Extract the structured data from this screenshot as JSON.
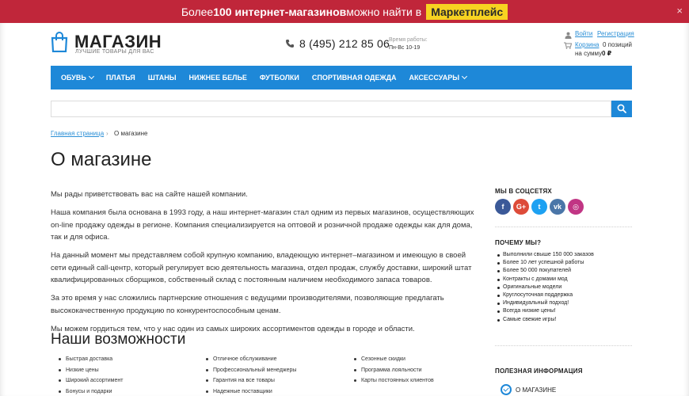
{
  "promo": {
    "text_prefix": "Более ",
    "text_bold": "100 интернет-магазинов",
    "text_suffix": " можно найти в",
    "badge": "Маркетплейс",
    "close": "×"
  },
  "header": {
    "logo_title": "МАГАЗИН",
    "logo_subtitle": "ЛУЧШИЕ ТОВАРЫ ДЛЯ ВАС",
    "phone": "8 (495) 212 85 06",
    "hours_label": "Время работы:",
    "hours_value": "Пн-Вс 10-19",
    "login": "Войти",
    "register": "Регистрация",
    "cart": "Корзина",
    "cart_count": "0 позиций",
    "cart_sum_label": "на сумму",
    "cart_sum_value": "0 ₽"
  },
  "nav": {
    "items": [
      {
        "label": "ОБУВЬ",
        "dropdown": true
      },
      {
        "label": "ПЛАТЬЯ",
        "dropdown": false
      },
      {
        "label": "ШТАНЫ",
        "dropdown": false
      },
      {
        "label": "НИЖНЕЕ БЕЛЬЕ",
        "dropdown": false
      },
      {
        "label": "ФУТБОЛКИ",
        "dropdown": false
      },
      {
        "label": "СПОРТИВНАЯ ОДЕЖДА",
        "dropdown": false
      },
      {
        "label": "АКСЕССУАРЫ",
        "dropdown": true
      }
    ]
  },
  "search": {
    "placeholder": "",
    "button_icon": "search-icon"
  },
  "breadcrumb": {
    "home": "Главная страница",
    "separator": "›",
    "current": "О магазине"
  },
  "page_title": "О магазине",
  "content": {
    "paragraphs": [
      "Мы рады приветствовать вас на сайте нашей компании.",
      "Наша компания была основана в 1993 году, а наш интернет-магазин стал одним из первых магазинов, осуществляющих on-line продажу одежды в регионе. Компания специализируется на оптовой и розничной продаже одежды как для дома, так и для офиса.",
      "На данный момент мы представляем собой крупную компанию, владеющую интернет–магазином и имеющую в своей сети единый call-центр, который регулирует всю деятельность магазина, отдел продаж, службу доставки, широкий штат квалифицированных сборщиков, собственный склад с постоянным наличием необходимого запаса товаров.",
      "За это время у нас сложились партнерские отношения с ведущими производителями, позволяющие предлагать высококачественную продукцию по конкурентоспособным ценам.",
      "Мы можем гордиться тем, что у нас один из самых широких ассортиментов одежды в городе и области."
    ],
    "features_title": "Наши возможности",
    "features_col1": [
      "Быстрая доставка",
      "Низкие цены",
      "Широкий ассортимент",
      "Бонусы и подарки"
    ],
    "features_col2": [
      "Отличное обслуживание",
      "Профессиональный менеджеры",
      "Гарантия на все товары",
      "Надежные поставщики"
    ],
    "features_col3": [
      "Сезонные скидки",
      "Программа лояльности",
      "Карты постоянных клиентов"
    ]
  },
  "sidebar": {
    "social_title": "МЫ В СОЦСЕТЯХ",
    "social": [
      {
        "icon": "facebook-icon",
        "glyph": "f",
        "color": "#3b5998"
      },
      {
        "icon": "google-plus-icon",
        "glyph": "G+",
        "color": "#dd4b39"
      },
      {
        "icon": "twitter-icon",
        "glyph": "t",
        "color": "#1da1f2"
      },
      {
        "icon": "vk-icon",
        "glyph": "vk",
        "color": "#4a76a8"
      },
      {
        "icon": "instagram-icon",
        "glyph": "◎",
        "color": "#c13584"
      }
    ],
    "why_title": "ПОЧЕМУ МЫ?",
    "why_items": [
      "Выполнили свыше 150 000 заказов",
      "Более 10 лет успешной работы",
      "Более 50 000 покупателей",
      "Контракты с домами мод",
      "Оригинальные модели",
      "Круглосуточная поддержка",
      "Индивидуальный подход!",
      "Всегда низкие цены!",
      "Самые свежие игры!"
    ],
    "info_title": "ПОЛЕЗНАЯ ИНФОРМАЦИЯ",
    "info_item": "О МАГАЗИНЕ"
  },
  "colors": {
    "promo_bg": "#c0263a",
    "badge_bg": "#f7d321",
    "accent": "#1e88d8",
    "link": "#2b8fd6"
  }
}
